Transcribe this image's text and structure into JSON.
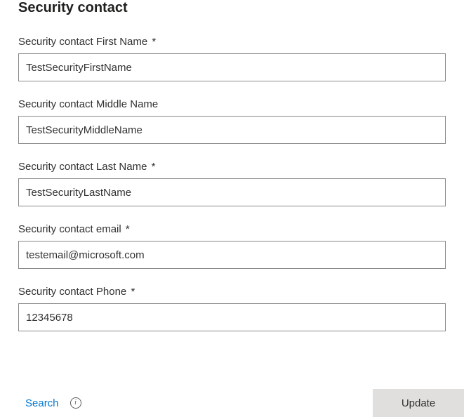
{
  "section": {
    "title": "Security contact"
  },
  "fields": {
    "firstName": {
      "label": "Security contact First Name",
      "required": "*",
      "value": "TestSecurityFirstName"
    },
    "middleName": {
      "label": "Security contact Middle Name",
      "required": "",
      "value": "TestSecurityMiddleName"
    },
    "lastName": {
      "label": "Security contact Last Name",
      "required": "*",
      "value": "TestSecurityLastName"
    },
    "email": {
      "label": "Security contact email",
      "required": "*",
      "value": "testemail@microsoft.com"
    },
    "phone": {
      "label": "Security contact Phone",
      "required": "*",
      "value": "12345678"
    }
  },
  "footer": {
    "searchLabel": "Search",
    "infoGlyph": "i",
    "updateLabel": "Update"
  }
}
